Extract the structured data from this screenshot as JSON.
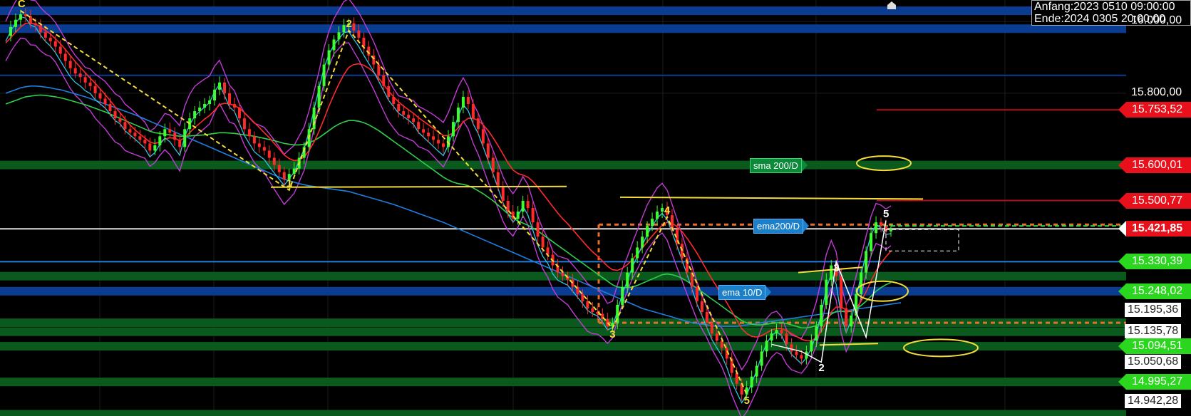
{
  "info_box": {
    "start": "Anfang:2023 0510 09:00:00",
    "end": "Ende:2024 0305 20:00:00"
  },
  "chart_data": {
    "type": "line",
    "title": "",
    "y_axis_ticks": [
      {
        "label": "16.000,00",
        "value": 16000
      },
      {
        "label": "15.800,00",
        "value": 15800
      }
    ],
    "ylim": [
      14900,
      16060
    ],
    "price_tags": [
      {
        "label": "15.753,52",
        "value": 15753.52,
        "color": "red"
      },
      {
        "label": "15.600,01",
        "value": 15600.01,
        "color": "red"
      },
      {
        "label": "15.500,77",
        "value": 15500.77,
        "color": "red"
      },
      {
        "label": "15.421,85",
        "value": 15421.85,
        "color": "current"
      },
      {
        "label": "15.330,39",
        "value": 15330.39,
        "color": "green"
      },
      {
        "label": "15.248,02",
        "value": 15248.02,
        "color": "green"
      },
      {
        "label": "15.094,51",
        "value": 15094.51,
        "color": "green"
      },
      {
        "label": "14.995,27",
        "value": 14995.27,
        "color": "green"
      }
    ],
    "side_labels": [
      {
        "label": "15.195,36",
        "value": 15195.36
      },
      {
        "label": "15.135,78",
        "value": 15135.78
      },
      {
        "label": "15.050,68",
        "value": 15050.68
      },
      {
        "label": "14.942,28",
        "value": 14942.28
      }
    ],
    "indicator_labels": [
      {
        "label": "sma 200/D",
        "value": 15600,
        "style": "green"
      },
      {
        "label": "ema200/D",
        "value": 15430,
        "style": "blue"
      },
      {
        "label": "ema 10/D",
        "value": 15245,
        "style": "blue"
      }
    ],
    "wave_labels": [
      {
        "label": "C",
        "idx": 3,
        "value": 16030,
        "color": "yellow"
      },
      {
        "label": "1",
        "idx": 57,
        "value": 15530,
        "color": "yellow"
      },
      {
        "label": "2",
        "idx": 69,
        "value": 15975,
        "color": "yellow"
      },
      {
        "label": "3",
        "idx": 122,
        "value": 15145,
        "color": "yellow"
      },
      {
        "label": "4",
        "idx": 133,
        "value": 15455,
        "color": "yellow"
      },
      {
        "label": "5",
        "idx": 149,
        "value": 14960,
        "color": "yellow"
      },
      {
        "label": "3",
        "idx": 167,
        "value": 15330,
        "color": "white"
      },
      {
        "label": "2",
        "idx": 164,
        "value": 15050,
        "color": "white"
      },
      {
        "label": "5",
        "idx": 177,
        "value": 15445,
        "color": "white"
      }
    ],
    "price_series": [
      15960,
      15985,
      16005,
      16020,
      16015,
      15995,
      15990,
      15970,
      15955,
      15945,
      15930,
      15910,
      15890,
      15870,
      15855,
      15845,
      15830,
      15820,
      15800,
      15785,
      15770,
      15750,
      15730,
      15720,
      15700,
      15690,
      15680,
      15670,
      15660,
      15640,
      15655,
      15680,
      15700,
      15690,
      15670,
      15650,
      15700,
      15730,
      15750,
      15760,
      15770,
      15780,
      15810,
      15830,
      15800,
      15770,
      15760,
      15730,
      15700,
      15680,
      15660,
      15650,
      15640,
      15620,
      15600,
      15580,
      15560,
      15575,
      15590,
      15620,
      15650,
      15700,
      15760,
      15820,
      15880,
      15920,
      15950,
      15970,
      15990,
      15995,
      15975,
      15955,
      15930,
      15905,
      15880,
      15850,
      15820,
      15790,
      15770,
      15750,
      15740,
      15730,
      15720,
      15700,
      15690,
      15680,
      15670,
      15660,
      15650,
      15680,
      15720,
      15760,
      15790,
      15770,
      15730,
      15700,
      15660,
      15620,
      15580,
      15540,
      15500,
      15470,
      15450,
      15470,
      15500,
      15480,
      15440,
      15400,
      15370,
      15350,
      15320,
      15300,
      15290,
      15280,
      15260,
      15240,
      15220,
      15200,
      15190,
      15185,
      15170,
      15150,
      15160,
      15210,
      15260,
      15300,
      15340,
      15370,
      15400,
      15430,
      15450,
      15470,
      15480,
      15460,
      15420,
      15380,
      15340,
      15300,
      15260,
      15220,
      15190,
      15160,
      15130,
      15110,
      15090,
      15060,
      15020,
      14990,
      14960,
      14980,
      15010,
      15040,
      15080,
      15110,
      15130,
      15140,
      15130,
      15100,
      15080,
      15070,
      15060,
      15080,
      15110,
      15150,
      15210,
      15280,
      15320,
      15290,
      15200,
      15150,
      15180,
      15240,
      15300,
      15360,
      15410,
      15440,
      15430,
      15415,
      15420
    ],
    "series": [
      {
        "name": "sma 200/D",
        "color": "#1e7fe0",
        "values": [
          15800,
          15805,
          15810,
          15815,
          15818,
          15820,
          15820,
          15819,
          15817,
          15815,
          15812,
          15810,
          15806,
          15802,
          15798,
          15794,
          15790,
          15785,
          15780,
          15775,
          15770,
          15765,
          15760,
          15755,
          15750,
          15745,
          15740,
          15734,
          15728,
          15722,
          15716,
          15710,
          15704,
          15698,
          15692,
          15686,
          15680,
          15674,
          15668,
          15662,
          15656,
          15650,
          15644,
          15638,
          15632,
          15626,
          15620,
          15614,
          15608,
          15602,
          15596,
          15590,
          15584,
          15578,
          15572,
          15566,
          15560,
          15556,
          15552,
          15548,
          15545,
          15542,
          15540,
          15538,
          15536,
          15534,
          15532,
          15530,
          15528,
          15526,
          15522,
          15518,
          15514,
          15510,
          15506,
          15502,
          15498,
          15494,
          15490,
          15485,
          15480,
          15475,
          15470,
          15465,
          15460,
          15455,
          15450,
          15445,
          15440,
          15434,
          15428,
          15422,
          15416,
          15410,
          15404,
          15398,
          15392,
          15386,
          15380,
          15374,
          15368,
          15362,
          15356,
          15350,
          15344,
          15338,
          15332,
          15326,
          15320,
          15314,
          15308,
          15302,
          15296,
          15290,
          15284,
          15278,
          15272,
          15266,
          15260,
          15254,
          15248,
          15242,
          15236,
          15230,
          15224,
          15218,
          15212,
          15206,
          15200,
          15196,
          15192,
          15188,
          15184,
          15180,
          15176,
          15172,
          15168,
          15164,
          15160,
          15158,
          15156,
          15154,
          15152,
          15150,
          15150,
          15150,
          15150,
          15150,
          15152,
          15154,
          15156,
          15158,
          15160,
          15162,
          15164,
          15166,
          15168,
          15170,
          15172,
          15174,
          15176,
          15178,
          15180,
          15182,
          15184,
          15186,
          15188,
          15190,
          15192,
          15194,
          15196,
          15198,
          15200,
          15202,
          15204,
          15206,
          15208,
          15210,
          15212,
          15214,
          15216
        ]
      },
      {
        "name": "ema200/D",
        "color": "#2fd04a",
        "values": [
          15770,
          15775,
          15780,
          15785,
          15790,
          15792,
          15794,
          15795,
          15794,
          15792,
          15790,
          15787,
          15784,
          15780,
          15776,
          15772,
          15768,
          15763,
          15758,
          15753,
          15748,
          15742,
          15736,
          15730,
          15724,
          15718,
          15712,
          15706,
          15700,
          15694,
          15690,
          15688,
          15686,
          15684,
          15682,
          15680,
          15680,
          15681,
          15682,
          15683,
          15684,
          15686,
          15688,
          15690,
          15690,
          15689,
          15688,
          15686,
          15684,
          15682,
          15680,
          15677,
          15674,
          15671,
          15668,
          15664,
          15660,
          15658,
          15656,
          15656,
          15658,
          15662,
          15668,
          15676,
          15686,
          15696,
          15706,
          15714,
          15720,
          15724,
          15724,
          15722,
          15718,
          15712,
          15704,
          15696,
          15686,
          15676,
          15666,
          15656,
          15646,
          15636,
          15626,
          15616,
          15606,
          15596,
          15586,
          15576,
          15566,
          15558,
          15552,
          15548,
          15546,
          15542,
          15536,
          15528,
          15520,
          15510,
          15500,
          15488,
          15476,
          15464,
          15452,
          15444,
          15438,
          15432,
          15424,
          15416,
          15406,
          15396,
          15386,
          15376,
          15366,
          15356,
          15346,
          15336,
          15326,
          15316,
          15306,
          15296,
          15286,
          15276,
          15266,
          15260,
          15258,
          15258,
          15260,
          15264,
          15270,
          15276,
          15282,
          15288,
          15294,
          15296,
          15294,
          15290,
          15284,
          15276,
          15266,
          15256,
          15246,
          15236,
          15226,
          15216,
          15206,
          15196,
          15186,
          15176,
          15166,
          15160,
          15156,
          15154,
          15154,
          15156,
          15158,
          15160,
          15160,
          15158,
          15154,
          15150,
          15146,
          15146,
          15148,
          15152,
          15160,
          15172,
          15184,
          15192,
          15192,
          15190,
          15192,
          15198,
          15208,
          15220,
          15234,
          15248,
          15258,
          15266,
          15272
        ]
      },
      {
        "name": "ema 10/D",
        "color": "#ff2a2a",
        "values": [
          15940,
          15955,
          15970,
          15985,
          15995,
          15995,
          15993,
          15985,
          15975,
          15965,
          15952,
          15938,
          15922,
          15905,
          15888,
          15872,
          15857,
          15842,
          15828,
          15812,
          15796,
          15780,
          15762,
          15746,
          15728,
          15712,
          15698,
          15686,
          15675,
          15664,
          15660,
          15664,
          15672,
          15676,
          15674,
          15668,
          15676,
          15690,
          15704,
          15716,
          15728,
          15738,
          15752,
          15768,
          15772,
          15770,
          15766,
          15758,
          15746,
          15732,
          15718,
          15704,
          15690,
          15676,
          15660,
          15644,
          15628,
          15618,
          15612,
          15614,
          15622,
          15640,
          15664,
          15694,
          15728,
          15764,
          15796,
          15826,
          15852,
          15872,
          15880,
          15882,
          15878,
          15870,
          15858,
          15842,
          15824,
          15806,
          15790,
          15776,
          15764,
          15754,
          15744,
          15732,
          15722,
          15712,
          15702,
          15692,
          15682,
          15682,
          15690,
          15704,
          15720,
          15730,
          15730,
          15724,
          15712,
          15696,
          15676,
          15654,
          15630,
          15606,
          15586,
          15576,
          15572,
          15566,
          15554,
          15538,
          15520,
          15502,
          15484,
          15466,
          15450,
          15436,
          15420,
          15404,
          15388,
          15372,
          15358,
          15346,
          15332,
          15318,
          15308,
          15306,
          15312,
          15322,
          15336,
          15352,
          15368,
          15386,
          15402,
          15418,
          15432,
          15440,
          15438,
          15428,
          15414,
          15396,
          15376,
          15354,
          15330,
          15306,
          15282,
          15260,
          15238,
          15216,
          15192,
          15168,
          15144,
          15130,
          15122,
          15120,
          15124,
          15132,
          15140,
          15144,
          15144,
          15138,
          15130,
          15122,
          15114,
          15110,
          15110,
          15118,
          15136,
          15162,
          15190,
          15204,
          15204,
          15196,
          15192,
          15200,
          15220,
          15246,
          15276,
          15304,
          15326,
          15344,
          15360
        ]
      }
    ],
    "horizontal_levels": [
      {
        "value": 16030,
        "color": "#0a3d91",
        "kind": "band"
      },
      {
        "value": 15980,
        "color": "#0a3d91",
        "kind": "band"
      },
      {
        "value": 15850,
        "color": "#0a3d91",
        "kind": "line"
      },
      {
        "value": 15753.52,
        "color": "#b01018",
        "kind": "line"
      },
      {
        "value": 15600,
        "color": "#0a5a1e",
        "kind": "band"
      },
      {
        "value": 15500.77,
        "color": "#b01018",
        "kind": "line"
      },
      {
        "value": 15421.85,
        "color": "#dddddd",
        "kind": "line"
      },
      {
        "value": 15330.39,
        "color": "#1e7fe0",
        "kind": "line"
      },
      {
        "value": 15290,
        "color": "#0a5a1e",
        "kind": "band"
      },
      {
        "value": 15248.02,
        "color": "#0a3d91",
        "kind": "band"
      },
      {
        "value": 15160,
        "color": "#0a5a1e",
        "kind": "band"
      },
      {
        "value": 15135,
        "color": "#0a5a1e",
        "kind": "band"
      },
      {
        "value": 15094.51,
        "color": "#0a5a1e",
        "kind": "band"
      },
      {
        "value": 14995,
        "color": "#0a5a1e",
        "kind": "band"
      },
      {
        "value": 14905,
        "color": "#0a5a1e",
        "kind": "band"
      }
    ]
  },
  "colors": {
    "background": "#000000",
    "yellow": "#f4dd3a",
    "magenta": "#c23bd6",
    "cyan": "#2ec4e6",
    "orange_dotted": "#e8702a"
  }
}
